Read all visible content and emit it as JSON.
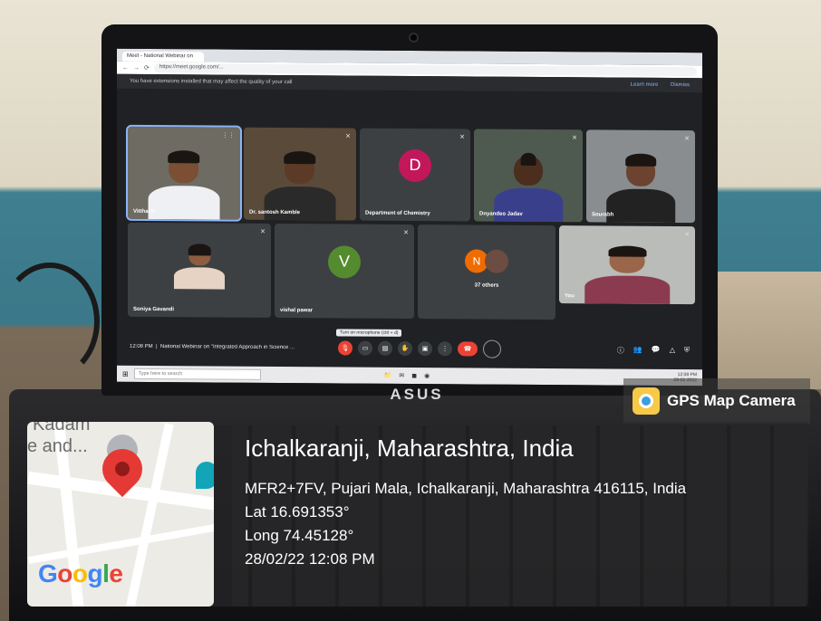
{
  "browser": {
    "tabs": [
      "Meet - National Webinar on",
      ""
    ],
    "url": "https://meet.google.com/..."
  },
  "meet": {
    "notice": "You have extensions installed that may affect the quality of your call",
    "notice_links": [
      "Learn more",
      "Dismiss"
    ],
    "participants": [
      {
        "name": "Vitthal D",
        "type": "video"
      },
      {
        "name": "Dr. santosh Kamble",
        "type": "video"
      },
      {
        "name": "Department of Chemistry",
        "type": "avatar",
        "initial": "D",
        "color": "#c2185b"
      },
      {
        "name": "Dnyandeo Jadav",
        "type": "video"
      },
      {
        "name": "Sourabh",
        "type": "video"
      },
      {
        "name": "Soniya Gavandi",
        "type": "video"
      },
      {
        "name": "vishal pawar",
        "type": "avatar",
        "initial": "V",
        "color": "#558b2f"
      },
      {
        "name": "37 others",
        "type": "group",
        "initial": "N",
        "color": "#ef6c00"
      },
      {
        "name": "You",
        "type": "video"
      }
    ],
    "time": "12:08 PM",
    "meeting_title": "National Webinar on \"Integrated Approach in Science ...",
    "tooltip": "Turn on microphone (ctrl + d)"
  },
  "taskbar": {
    "search_placeholder": "Type here to search",
    "time": "12:08 PM",
    "date": "28-02-2022"
  },
  "laptop_brand": "ASUS",
  "gps": {
    "app_name": "GPS Map Camera",
    "place": "Ichalkaranji, Maharashtra, India",
    "address": "MFR2+7FV, Pujari Mala, Ichalkaranji, Maharashtra 416115, India",
    "lat": "Lat 16.691353°",
    "long": "Long 74.45128°",
    "datetime": "28/02/22 12:08 PM",
    "map_text_1": "Kadam",
    "map_text_2": "e and...",
    "map_logo": "Google"
  }
}
